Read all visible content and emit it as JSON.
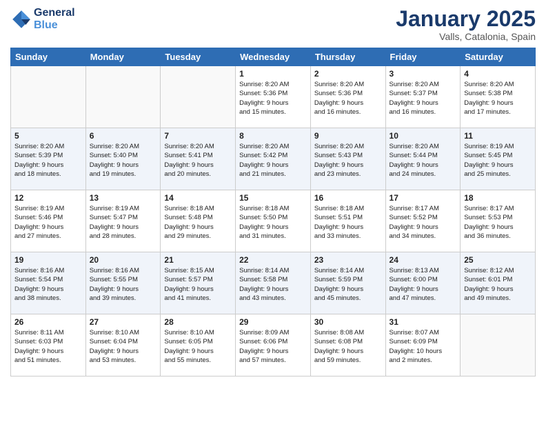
{
  "header": {
    "logo_line1": "General",
    "logo_line2": "Blue",
    "month": "January 2025",
    "location": "Valls, Catalonia, Spain"
  },
  "days_of_week": [
    "Sunday",
    "Monday",
    "Tuesday",
    "Wednesday",
    "Thursday",
    "Friday",
    "Saturday"
  ],
  "weeks": [
    [
      {
        "day": "",
        "info": ""
      },
      {
        "day": "",
        "info": ""
      },
      {
        "day": "",
        "info": ""
      },
      {
        "day": "1",
        "info": "Sunrise: 8:20 AM\nSunset: 5:36 PM\nDaylight: 9 hours\nand 15 minutes."
      },
      {
        "day": "2",
        "info": "Sunrise: 8:20 AM\nSunset: 5:36 PM\nDaylight: 9 hours\nand 16 minutes."
      },
      {
        "day": "3",
        "info": "Sunrise: 8:20 AM\nSunset: 5:37 PM\nDaylight: 9 hours\nand 16 minutes."
      },
      {
        "day": "4",
        "info": "Sunrise: 8:20 AM\nSunset: 5:38 PM\nDaylight: 9 hours\nand 17 minutes."
      }
    ],
    [
      {
        "day": "5",
        "info": "Sunrise: 8:20 AM\nSunset: 5:39 PM\nDaylight: 9 hours\nand 18 minutes."
      },
      {
        "day": "6",
        "info": "Sunrise: 8:20 AM\nSunset: 5:40 PM\nDaylight: 9 hours\nand 19 minutes."
      },
      {
        "day": "7",
        "info": "Sunrise: 8:20 AM\nSunset: 5:41 PM\nDaylight: 9 hours\nand 20 minutes."
      },
      {
        "day": "8",
        "info": "Sunrise: 8:20 AM\nSunset: 5:42 PM\nDaylight: 9 hours\nand 21 minutes."
      },
      {
        "day": "9",
        "info": "Sunrise: 8:20 AM\nSunset: 5:43 PM\nDaylight: 9 hours\nand 23 minutes."
      },
      {
        "day": "10",
        "info": "Sunrise: 8:20 AM\nSunset: 5:44 PM\nDaylight: 9 hours\nand 24 minutes."
      },
      {
        "day": "11",
        "info": "Sunrise: 8:19 AM\nSunset: 5:45 PM\nDaylight: 9 hours\nand 25 minutes."
      }
    ],
    [
      {
        "day": "12",
        "info": "Sunrise: 8:19 AM\nSunset: 5:46 PM\nDaylight: 9 hours\nand 27 minutes."
      },
      {
        "day": "13",
        "info": "Sunrise: 8:19 AM\nSunset: 5:47 PM\nDaylight: 9 hours\nand 28 minutes."
      },
      {
        "day": "14",
        "info": "Sunrise: 8:18 AM\nSunset: 5:48 PM\nDaylight: 9 hours\nand 29 minutes."
      },
      {
        "day": "15",
        "info": "Sunrise: 8:18 AM\nSunset: 5:50 PM\nDaylight: 9 hours\nand 31 minutes."
      },
      {
        "day": "16",
        "info": "Sunrise: 8:18 AM\nSunset: 5:51 PM\nDaylight: 9 hours\nand 33 minutes."
      },
      {
        "day": "17",
        "info": "Sunrise: 8:17 AM\nSunset: 5:52 PM\nDaylight: 9 hours\nand 34 minutes."
      },
      {
        "day": "18",
        "info": "Sunrise: 8:17 AM\nSunset: 5:53 PM\nDaylight: 9 hours\nand 36 minutes."
      }
    ],
    [
      {
        "day": "19",
        "info": "Sunrise: 8:16 AM\nSunset: 5:54 PM\nDaylight: 9 hours\nand 38 minutes."
      },
      {
        "day": "20",
        "info": "Sunrise: 8:16 AM\nSunset: 5:55 PM\nDaylight: 9 hours\nand 39 minutes."
      },
      {
        "day": "21",
        "info": "Sunrise: 8:15 AM\nSunset: 5:57 PM\nDaylight: 9 hours\nand 41 minutes."
      },
      {
        "day": "22",
        "info": "Sunrise: 8:14 AM\nSunset: 5:58 PM\nDaylight: 9 hours\nand 43 minutes."
      },
      {
        "day": "23",
        "info": "Sunrise: 8:14 AM\nSunset: 5:59 PM\nDaylight: 9 hours\nand 45 minutes."
      },
      {
        "day": "24",
        "info": "Sunrise: 8:13 AM\nSunset: 6:00 PM\nDaylight: 9 hours\nand 47 minutes."
      },
      {
        "day": "25",
        "info": "Sunrise: 8:12 AM\nSunset: 6:01 PM\nDaylight: 9 hours\nand 49 minutes."
      }
    ],
    [
      {
        "day": "26",
        "info": "Sunrise: 8:11 AM\nSunset: 6:03 PM\nDaylight: 9 hours\nand 51 minutes."
      },
      {
        "day": "27",
        "info": "Sunrise: 8:10 AM\nSunset: 6:04 PM\nDaylight: 9 hours\nand 53 minutes."
      },
      {
        "day": "28",
        "info": "Sunrise: 8:10 AM\nSunset: 6:05 PM\nDaylight: 9 hours\nand 55 minutes."
      },
      {
        "day": "29",
        "info": "Sunrise: 8:09 AM\nSunset: 6:06 PM\nDaylight: 9 hours\nand 57 minutes."
      },
      {
        "day": "30",
        "info": "Sunrise: 8:08 AM\nSunset: 6:08 PM\nDaylight: 9 hours\nand 59 minutes."
      },
      {
        "day": "31",
        "info": "Sunrise: 8:07 AM\nSunset: 6:09 PM\nDaylight: 10 hours\nand 2 minutes."
      },
      {
        "day": "",
        "info": ""
      }
    ]
  ]
}
